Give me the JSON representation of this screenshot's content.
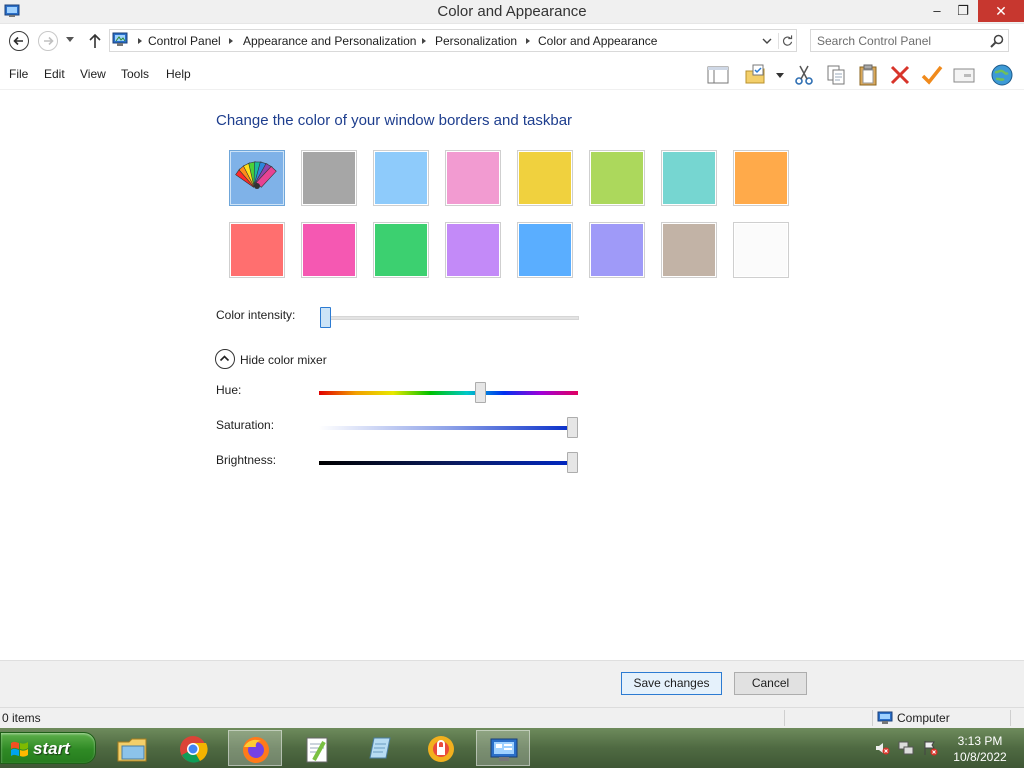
{
  "window": {
    "title": "Color and Appearance",
    "minimize": "–",
    "maximize": "❐",
    "close": "✕"
  },
  "address": {
    "breadcrumbs": [
      "Control Panel",
      "Appearance and Personalization",
      "Personalization",
      "Color and Appearance"
    ],
    "search_placeholder": "Search Control Panel"
  },
  "menu": [
    "File",
    "Edit",
    "View",
    "Tools",
    "Help"
  ],
  "toolbar_icons": [
    "layout-icon",
    "folder-options-icon",
    "cut-icon",
    "copy-icon",
    "paste-icon",
    "delete-icon",
    "check-icon",
    "properties-icon",
    "globe-icon"
  ],
  "content": {
    "heading": "Change the color of your window borders and taskbar",
    "swatches": [
      {
        "name": "automatic",
        "color": "#7fb2e8",
        "selected": true
      },
      {
        "name": "sky-gray",
        "color": "#a6a6a6"
      },
      {
        "name": "sky-blue",
        "color": "#8ecbfb"
      },
      {
        "name": "pink",
        "color": "#f29bd1"
      },
      {
        "name": "yellow",
        "color": "#f0d13e"
      },
      {
        "name": "lime",
        "color": "#acd85c"
      },
      {
        "name": "teal",
        "color": "#76d6d1"
      },
      {
        "name": "orange",
        "color": "#ffaa4a"
      },
      {
        "name": "red",
        "color": "#ff6f6f"
      },
      {
        "name": "magenta",
        "color": "#f558b2"
      },
      {
        "name": "green",
        "color": "#3cd070"
      },
      {
        "name": "violet",
        "color": "#c38af8"
      },
      {
        "name": "blue",
        "color": "#5aaeff"
      },
      {
        "name": "periwinkle",
        "color": "#9f9af8"
      },
      {
        "name": "taupe",
        "color": "#c2b3a6"
      },
      {
        "name": "white",
        "color": "#fbfbfb"
      }
    ],
    "intensity_label": "Color intensity:",
    "intensity_value": 0.0,
    "mixer_toggle_label": "Hide color mixer",
    "hue_label": "Hue:",
    "hue_value": 0.63,
    "saturation_label": "Saturation:",
    "saturation_value": 1.0,
    "brightness_label": "Brightness:",
    "brightness_value": 1.0
  },
  "buttons": {
    "save": "Save changes",
    "cancel": "Cancel"
  },
  "status": {
    "items": "0 items",
    "location": "Computer"
  },
  "taskbar": {
    "start": "start",
    "apps": [
      "file-explorer",
      "chrome",
      "firefox",
      "notepad-plus-plus",
      "notepad",
      "security",
      "control-panel"
    ],
    "active_app": "control-panel",
    "time": "3:13 PM",
    "date": "10/8/2022"
  },
  "colors": {
    "heading": "#1e3e8e",
    "accent": "#2c7bd2",
    "close": "#c7372f"
  }
}
